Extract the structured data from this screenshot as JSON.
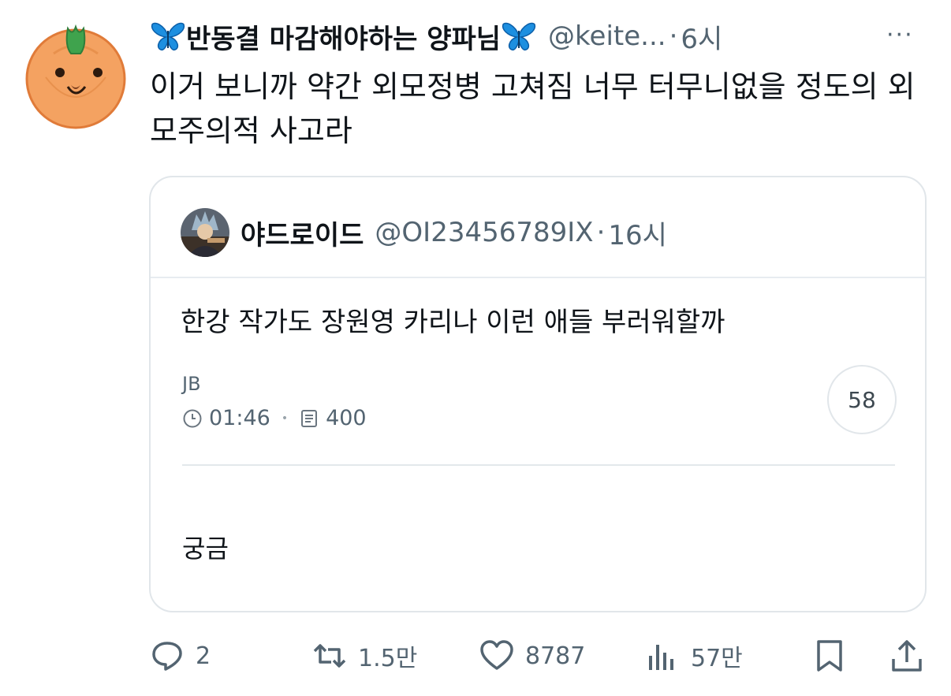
{
  "tweet": {
    "author_name": "반동결 마감해야하는 양파님",
    "author_handle": "@keite...",
    "separator": "·",
    "time": "6시",
    "more_label": "···",
    "text": "이거 보니까 약간 외모정병 고쳐짐 너무 터무니없을 정도의 외모주의적 사고라"
  },
  "quote": {
    "author_name": "야드로이드",
    "author_handle": "@OI23456789IX",
    "separator": "·",
    "time": "16시",
    "text": "한강 작가도 장원영 카리나 이런 애들 부러워할까",
    "source": "JB",
    "clock_time": "01:46",
    "doc_count": "400",
    "badge_count": "58",
    "comment": "궁금"
  },
  "actions": {
    "reply_count": "2",
    "retweet_count": "1.5만",
    "like_count": "8787",
    "views_count": "57만"
  },
  "icons": [
    "butterfly-icon",
    "clock-icon",
    "document-icon",
    "reply-icon",
    "retweet-icon",
    "heart-icon",
    "views-icon",
    "bookmark-icon",
    "share-icon"
  ],
  "colors": {
    "text": "#0f1419",
    "secondary": "#536471",
    "butterfly": "#1d8fe0",
    "avatar_orange": "#f4a261",
    "border": "#e1e6ea"
  }
}
